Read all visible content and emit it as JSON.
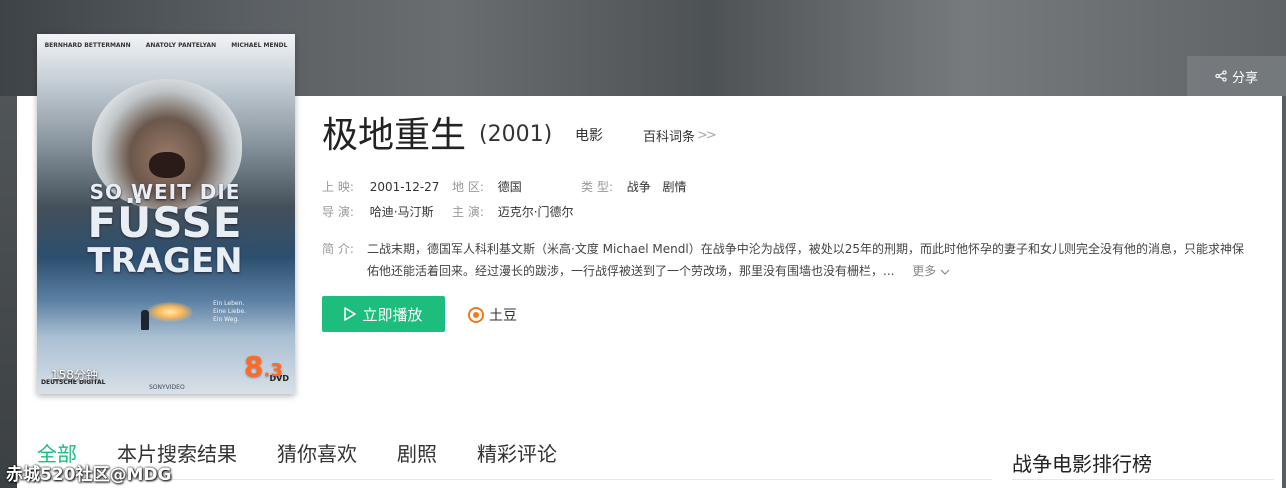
{
  "header": {
    "share_label": "分享"
  },
  "poster": {
    "names": [
      "BERNHARD BETTERMANN",
      "ANATOLY PANTELYAN",
      "MICHAEL MENDL"
    ],
    "title_lines": [
      "SO WEIT DIE",
      "FÜSSE",
      "TRAGEN"
    ],
    "tagline": [
      "Ein Leben.",
      "Eine Liebe.",
      "Ein Weg."
    ],
    "runtime": "158分钟",
    "score_main": "8",
    "score_decimal": ".3",
    "logo_left": "DEUTSCHE DIGITAL",
    "logo_right": "DVD",
    "studio": "SONYVIDEO"
  },
  "movie": {
    "title": "极地重生",
    "year": "(2001)",
    "type": "电影",
    "baike_label": "百科词条",
    "release_label": "上 映:",
    "release_value": "2001-12-27",
    "region_label": "地 区:",
    "region_value": "德国",
    "genre_label": "类 型:",
    "genres": [
      "战争",
      "剧情"
    ],
    "director_label": "导 演:",
    "director_value": "哈迪·马汀斯",
    "cast_label": "主 演:",
    "cast_value": "迈克尔·门德尔",
    "summary_label": "简 介:",
    "summary_line1": "二战末期，德国军人科利基文斯（米高·文度 Michael Mendl）在战争中沦为战俘，被处以25年的刑期，而此时他怀孕的妻子和女儿则完全没有他的消息，只能求神保",
    "summary_line2": "佑他还能活着回来。经过漫长的跋涉，一行战俘被送到了一个劳改场，那里没有围墙也没有栅栏，...",
    "more_label": "更多"
  },
  "actions": {
    "play_label": "立即播放",
    "source_label": "土豆"
  },
  "tabs": [
    "全部",
    "本片搜索结果",
    "猜你喜欢",
    "剧照",
    "精彩评论"
  ],
  "sidebar": {
    "rank_title": "战争电影排行榜"
  },
  "watermark": "赤城520社区@MDG",
  "colors": {
    "accent": "#1dbd7d",
    "score": "#ff6a24",
    "tudou": "#f07a1e"
  }
}
